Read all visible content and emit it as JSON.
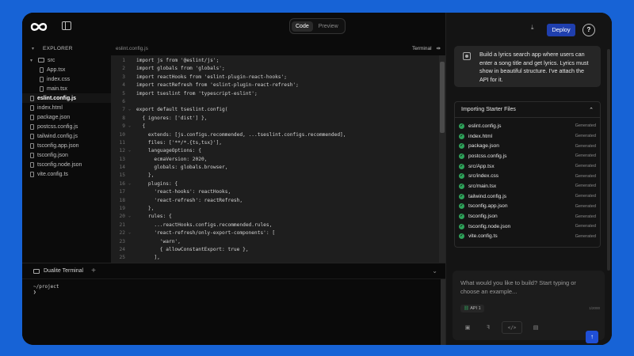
{
  "topbar": {
    "code_label": "Code",
    "preview_label": "Preview"
  },
  "explorer": {
    "title": "EXPLORER",
    "items": [
      {
        "label": "src",
        "type": "folder"
      },
      {
        "label": "App.tsx",
        "type": "file"
      },
      {
        "label": "index.css",
        "type": "file"
      },
      {
        "label": "main.tsx",
        "type": "file"
      },
      {
        "label": "eslint.config.js",
        "type": "file",
        "active": true
      },
      {
        "label": "index.html",
        "type": "file"
      },
      {
        "label": "package.json",
        "type": "file"
      },
      {
        "label": "postcss.config.js",
        "type": "file"
      },
      {
        "label": "tailwind.config.js",
        "type": "file"
      },
      {
        "label": "tsconfig.app.json",
        "type": "file"
      },
      {
        "label": "tsconfig.json",
        "type": "file"
      },
      {
        "label": "tsconfig.node.json",
        "type": "file"
      },
      {
        "label": "vite.config.ts",
        "type": "file"
      }
    ]
  },
  "editor": {
    "file_tab": "eslint.config.js",
    "terminal_toggle": "Terminal",
    "lines": [
      "import js from '@eslint/js';",
      "import globals from 'globals';",
      "import reactHooks from 'eslint-plugin-react-hooks';",
      "import reactRefresh from 'eslint-plugin-react-refresh';",
      "import tseslint from 'typescript-eslint';",
      "",
      "export default tseslint.config(",
      "  { ignores: ['dist'] },",
      "  {",
      "    extends: [js.configs.recommended, ...tseslint.configs.recommended],",
      "    files: ['**/*.{ts,tsx}'],",
      "    languageOptions: {",
      "      ecmaVersion: 2020,",
      "      globals: globals.browser,",
      "    },",
      "    plugins: {",
      "      'react-hooks': reactHooks,",
      "      'react-refresh': reactRefresh,",
      "    },",
      "    rules: {",
      "      ...reactHooks.configs.recommended.rules,",
      "      'react-refresh/only-export-components': [",
      "        'warn',",
      "        { allowConstantExport: true },",
      "      ],",
      "    },"
    ]
  },
  "terminal": {
    "tab_label": "Dualite Terminal",
    "path_line": "~/project",
    "prompt_line": "❯"
  },
  "right": {
    "deploy_label": "Deploy",
    "help_label": "?",
    "message": "Build a lyrics search app where users can enter a song title and get lyrics. Lyrics must show in beautiful structure. I've attach the API for it.",
    "import_title": "Importing Starter Files",
    "import_files": [
      {
        "name": "eslint.config.js",
        "status": "Generated"
      },
      {
        "name": "index.html",
        "status": "Generated"
      },
      {
        "name": "package.json",
        "status": "Generated"
      },
      {
        "name": "postcss.config.js",
        "status": "Generated"
      },
      {
        "name": "src/App.tsx",
        "status": "Generated"
      },
      {
        "name": "src/index.css",
        "status": "Generated"
      },
      {
        "name": "src/main.tsx",
        "status": "Generated"
      },
      {
        "name": "tailwind.config.js",
        "status": "Generated"
      },
      {
        "name": "tsconfig.app.json",
        "status": "Generated"
      },
      {
        "name": "tsconfig.json",
        "status": "Generated"
      },
      {
        "name": "tsconfig.node.json",
        "status": "Generated"
      },
      {
        "name": "vite.config.ts",
        "status": "Generated"
      }
    ],
    "input_placeholder": "What would you like to build? Start typing or choose an example...",
    "api_chip": "API 1",
    "counter": "1/2000",
    "tool_code_label": "</>"
  },
  "colors": {
    "accent": "#1f3fae",
    "success": "#2fa35b",
    "background": "#1763d6"
  }
}
